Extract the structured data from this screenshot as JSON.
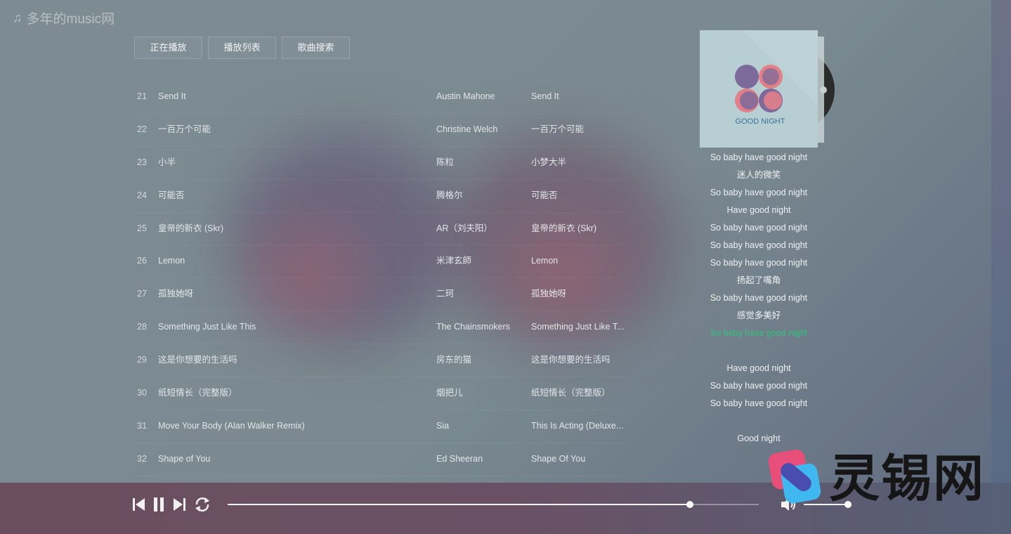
{
  "brand": {
    "title": "多年的music网",
    "icon": "music-note-icon"
  },
  "tabs": [
    {
      "label": "正在播放"
    },
    {
      "label": "播放列表"
    },
    {
      "label": "歌曲搜索"
    }
  ],
  "songs": [
    {
      "num": "21",
      "title": "Send It",
      "artist": "Austin Mahone",
      "album": "Send It"
    },
    {
      "num": "22",
      "title": "一百万个可能",
      "artist": "Christine Welch",
      "album": "一百万个可能"
    },
    {
      "num": "23",
      "title": "小半",
      "artist": "陈粒",
      "album": "小梦大半"
    },
    {
      "num": "24",
      "title": "可能否",
      "artist": "腾格尔",
      "album": "可能否"
    },
    {
      "num": "25",
      "title": "皇帝的新衣 (Skr)",
      "artist": "AR（刘夫阳）",
      "album": "皇帝的新衣 (Skr)"
    },
    {
      "num": "26",
      "title": "Lemon",
      "artist": "米津玄師",
      "album": "Lemon"
    },
    {
      "num": "27",
      "title": "孤独她呀",
      "artist": "二珂",
      "album": "孤独她呀"
    },
    {
      "num": "28",
      "title": "Something Just Like This",
      "artist": "The Chainsmokers",
      "album": "Something Just Like T..."
    },
    {
      "num": "29",
      "title": "这是你想要的生活吗",
      "artist": "房东的猫",
      "album": "这是你想要的生活吗"
    },
    {
      "num": "30",
      "title": "纸短情长（完整版）",
      "artist": "烟把儿",
      "album": "纸短情长（完整版）"
    },
    {
      "num": "31",
      "title": "Move Your Body (Alan Walker Remix)",
      "artist": "Sia",
      "album": "This Is Acting (Deluxe..."
    },
    {
      "num": "32",
      "title": "Shape of You",
      "artist": "Ed Sheeran",
      "album": "Shape Of You"
    }
  ],
  "album_cover": {
    "text": "GOOD NIGHT",
    "bg_color": "#b7cfd3",
    "text_color": "#3b6f9a"
  },
  "lyrics": [
    "So baby have good night",
    "迷人的微笑",
    "So baby have good night",
    "Have good night",
    "So baby have good night",
    "So baby have good night",
    "So baby have good night",
    "扬起了嘴角",
    "So baby have good night",
    "感觉多美好",
    "So baby have good night",
    "",
    "Have good night",
    "So baby have good night",
    "So baby have good night",
    "",
    "Good night"
  ],
  "lyrics_active_index": 10,
  "player": {
    "progress": 0.87,
    "volume": 0.93,
    "icons": [
      "prev-icon",
      "pause-icon",
      "next-icon",
      "loop-icon",
      "volume-icon"
    ]
  },
  "watermark": {
    "text": "灵锡网"
  },
  "colors": {
    "accent": "#31c27c"
  }
}
